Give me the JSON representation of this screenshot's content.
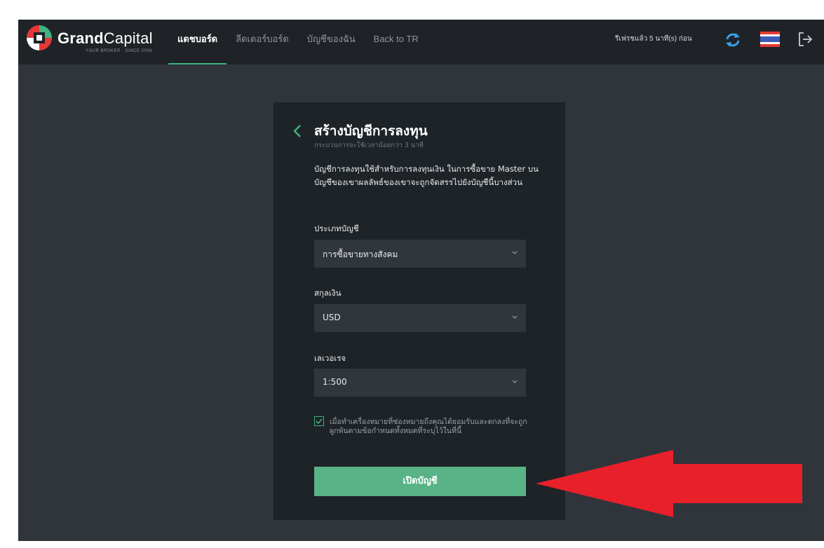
{
  "brand": {
    "name_bold": "Grand",
    "name_light": "Capital",
    "tagline": "YOUR BROKER · SINCE 2006"
  },
  "nav": {
    "items": [
      {
        "label": "แดชบอร์ด",
        "active": true
      },
      {
        "label": "ลีดเดอร์บอร์ด",
        "active": false
      },
      {
        "label": "บัญชีของฉัน",
        "active": false
      },
      {
        "label": "Back to TR",
        "active": false
      }
    ]
  },
  "header": {
    "refresh_text": "รีเฟรชแล้ว 5 นาที(s) ก่อน",
    "icons": [
      "refresh-icon",
      "thai-flag-menu-icon",
      "logout-icon"
    ]
  },
  "form": {
    "title": "สร้างบัญชีการลงทุน",
    "subtitle": "กระบวนการจะใช้เวลาน้อยกว่า 3 นาที",
    "description": "บัญชีการลงทุนใช้สำหรับการลงทุนเงิน ในการซื้อขาย Master บนบัญชีของเขาผลลัพธ์ของเขาจะถูกจัดสรรไปยังบัญชีนี้บางส่วน",
    "account_type": {
      "label": "ประเภทบัญชี",
      "value": "การซื้อขายทางสังคม"
    },
    "currency": {
      "label": "สกุลเงิน",
      "value": "USD"
    },
    "leverage": {
      "label": "เลเวอเรจ",
      "value": "1:500"
    },
    "agreement": {
      "checked": true,
      "text": "เมื่อทำเครื่องหมายที่ช่องหมายถึงคุณได้ยอมรับและตกลงที่จะถูกผูกพันตามข้อกำหนดทั้งหมดที่ระบุไว้ในที่นี้"
    },
    "submit_label": "เปิดบัญชี"
  },
  "colors": {
    "accent": "#3fb27f",
    "button": "#58b386",
    "topbar": "#1f2327",
    "background": "#2f353b",
    "card": "#1e2327",
    "annotation_arrow": "#e8202a"
  }
}
